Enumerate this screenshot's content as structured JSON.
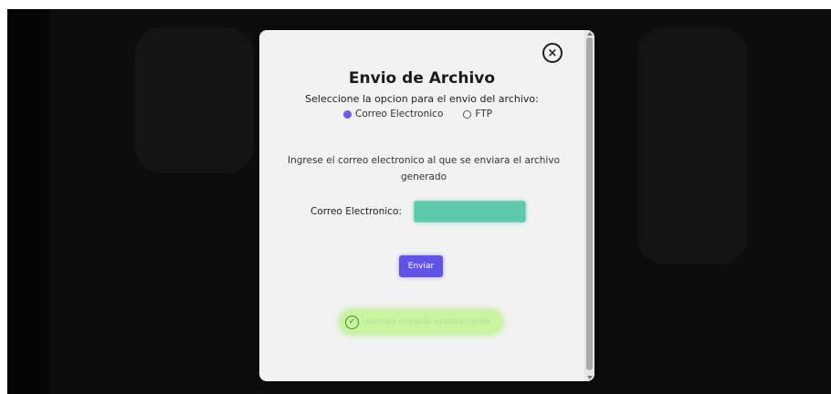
{
  "modal": {
    "title": "Envio de Archivo",
    "subtitle": "Seleccione la opcion para el envio del archivo:",
    "close_icon": "close-circle-icon",
    "options": [
      {
        "label": "Correo Electronico",
        "checked": true
      },
      {
        "label": "FTP",
        "checked": false
      }
    ],
    "instruction": "Ingrese el correo electronico al que se enviara el archivo generado",
    "email_label": "Correo Electronico:",
    "email_value": "",
    "send_label": "Enviar",
    "success_text": "Archivo enviado exitosamente",
    "success_icon": "check-circle-icon"
  },
  "colors": {
    "accent": "#6253e8",
    "email_field": "#5fc9ad",
    "success_bg": "#c9f4a2",
    "success_icon": "#3b8a2a"
  }
}
